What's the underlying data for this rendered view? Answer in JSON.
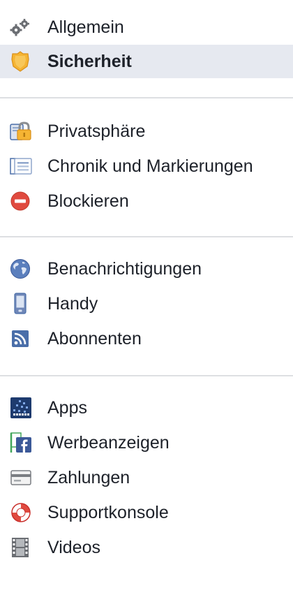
{
  "nav": {
    "groups": [
      {
        "items": [
          {
            "label": "Allgemein",
            "icon": "gears-icon",
            "selected": false
          },
          {
            "label": "Sicherheit",
            "icon": "shield-badge-icon",
            "selected": true
          }
        ]
      },
      {
        "items": [
          {
            "label": "Privatsphäre",
            "icon": "privacy-lock-icon",
            "selected": false
          },
          {
            "label": "Chronik und Markierungen",
            "icon": "timeline-tag-icon",
            "selected": false
          },
          {
            "label": "Blockieren",
            "icon": "block-icon",
            "selected": false
          }
        ]
      },
      {
        "items": [
          {
            "label": "Benachrichtigungen",
            "icon": "globe-icon",
            "selected": false
          },
          {
            "label": "Handy",
            "icon": "mobile-phone-icon",
            "selected": false
          },
          {
            "label": "Abonnenten",
            "icon": "rss-feed-icon",
            "selected": false
          }
        ]
      },
      {
        "items": [
          {
            "label": "Apps",
            "icon": "apps-grid-icon",
            "selected": false
          },
          {
            "label": "Werbeanzeigen",
            "icon": "ads-flag-icon",
            "selected": false
          },
          {
            "label": "Zahlungen",
            "icon": "credit-card-icon",
            "selected": false
          },
          {
            "label": "Supportkonsole",
            "icon": "lifebuoy-icon",
            "selected": false
          },
          {
            "label": "Videos",
            "icon": "film-strip-icon",
            "selected": false
          }
        ]
      }
    ]
  },
  "colors": {
    "selected_background": "#e6e9f0",
    "divider": "#dddfe2",
    "text": "#1d2129"
  }
}
